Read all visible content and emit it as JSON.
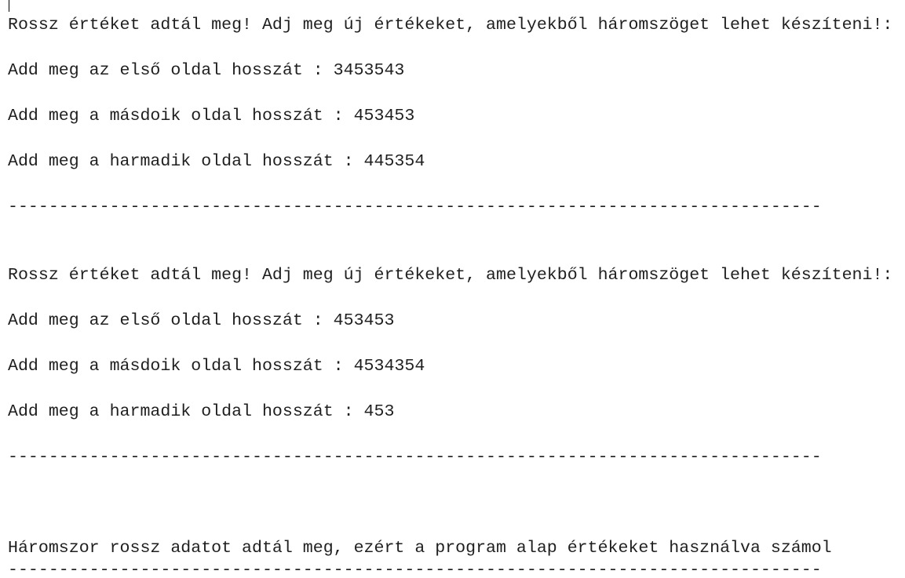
{
  "console": {
    "block1": {
      "error": "Rossz értéket adtál meg! Adj meg új értékeket, amelyekből háromszöget lehet készíteni!:",
      "side1": "Add meg az első oldal hosszát : 3453543",
      "side2": "Add meg a másdoik oldal hosszát : 453453",
      "side3": "Add meg a harmadik oldal hosszát : 445354",
      "separator": "--------------------------------------------------------------------------------"
    },
    "block2": {
      "error": "Rossz értéket adtál meg! Adj meg új értékeket, amelyekből háromszöget lehet készíteni!:",
      "side1": "Add meg az első oldal hosszát : 453453",
      "side2": "Add meg a másdoik oldal hosszát : 4534354",
      "side3": "Add meg a harmadik oldal hosszát : 453",
      "separator": "--------------------------------------------------------------------------------"
    },
    "final": {
      "message": "Háromszor rossz adatot adtál meg, ezért a program alap értékeket használva számol",
      "separator": "--------------------------------------------------------------------------------"
    }
  }
}
